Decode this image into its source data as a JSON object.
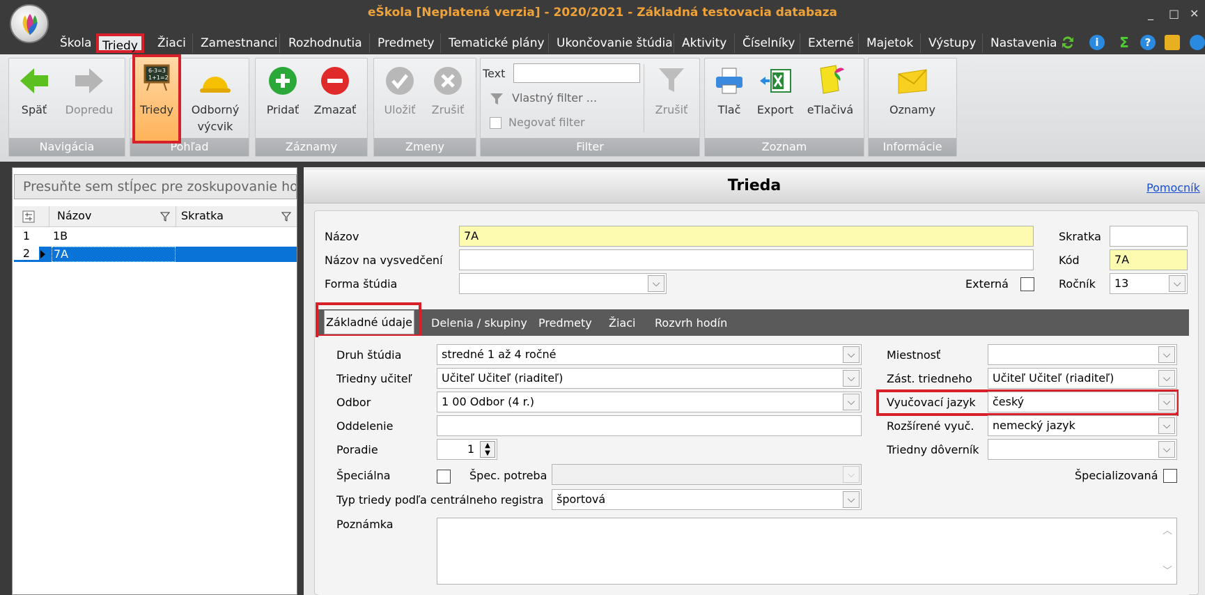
{
  "app": {
    "title": "eŠkola [Neplatená verzia] - 2020/2021 - Základná testovacia databaza",
    "window_controls": [
      "_",
      "□",
      "✕"
    ]
  },
  "menu": {
    "items": [
      "Škola",
      "Triedy",
      "Žiaci",
      "Zamestnanci",
      "Rozhodnutia",
      "Predmety",
      "Tematické plány",
      "Ukončovanie štúdia",
      "Aktivity",
      "Číselníky",
      "Externé",
      "Majetok",
      "Výstupy",
      "Nastavenia"
    ],
    "active": "Triedy"
  },
  "ribbon": {
    "navigacia": {
      "label": "Navigácia",
      "spat": "Späť",
      "dopredu": "Dopredu"
    },
    "pohlad": {
      "label": "Pohľad",
      "triedy": "Triedy",
      "odborny1": "Odborný",
      "odborny2": "výcvik"
    },
    "zaznamy": {
      "label": "Záznamy",
      "pridat": "Pridať",
      "zmazat": "Zmazať"
    },
    "zmeny": {
      "label": "Zmeny",
      "ulozit": "Uložiť",
      "zrusit": "Zrušiť"
    },
    "filter": {
      "label": "Filter",
      "text_label": "Text",
      "text_value": "",
      "vlastny": "Vlastný filter ...",
      "negovat": "Negovať filter",
      "zrusit": "Zrušiť"
    },
    "zoznam": {
      "label": "Zoznam",
      "tlac": "Tlač",
      "export": "Export",
      "etlaciva": "eTlačivá"
    },
    "informacie": {
      "label": "Informácie",
      "oznamy": "Oznamy"
    }
  },
  "grid": {
    "groupby_placeholder": "Presuňte sem stĺpec pre zoskupovanie hodn",
    "columns": [
      "Názov",
      "Skratka"
    ],
    "rows": [
      {
        "num": "1",
        "nazov": "1B",
        "skratka": ""
      },
      {
        "num": "2",
        "nazov": "7A",
        "skratka": ""
      }
    ]
  },
  "detail": {
    "title": "Trieda",
    "help_link": "Pomocník",
    "nazov_label": "Názov",
    "nazov": "7A",
    "nazov_vysv_label": "Názov na vysvedčení",
    "nazov_vysv": "",
    "forma_label": "Forma štúdia",
    "forma": "",
    "externa_label": "Externá",
    "skratka_label": "Skratka",
    "skratka": "",
    "kod_label": "Kód",
    "kod": "7A",
    "rocnik_label": "Ročník",
    "rocnik": "13"
  },
  "tabs": [
    "Základné údaje",
    "Delenia / skupiny",
    "Predmety",
    "Žiaci",
    "Rozvrh hodín"
  ],
  "zakladne": {
    "druh_label": "Druh štúdia",
    "druh": "stredné 1 až 4 ročné",
    "triedny_label": "Triedny učiteľ",
    "triedny": "Učiteľ Učiteľ (riaditeľ)",
    "odbor_label": "Odbor",
    "odbor": "1 00 Odbor (4 r.)",
    "oddelenie_label": "Oddelenie",
    "oddelenie": "",
    "poradie_label": "Poradie",
    "poradie": "1",
    "specialna_label": "Špeciálna",
    "spec_potreba_label": "Špec. potreba",
    "spec_potreba": "",
    "typ_label": "Typ triedy podľa centrálneho registra",
    "typ": "športová",
    "poznamka_label": "Poznámka",
    "poznamka": "",
    "miestnost_label": "Miestnosť",
    "miestnost": "",
    "zast_label": "Zást. triedneho",
    "zast": "Učiteľ Učiteľ (riaditeľ)",
    "jazyk_label": "Vyučovací jazyk",
    "jazyk": "český",
    "rozsirene_label": "Rozšírené vyuč.",
    "rozsirene": "nemecký jazyk",
    "doverník_label": "Triedny dôverník",
    "dovernik": "",
    "specializovana_label": "Špecializovaná"
  },
  "colors": {
    "highlight": "#d8202a",
    "selection": "#0a73d8",
    "title": "#f0a23a",
    "required": "#fdfbb0"
  }
}
